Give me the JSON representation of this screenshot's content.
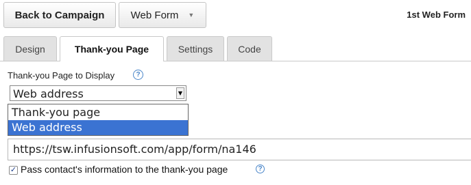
{
  "toolbar": {
    "back_label": "Back to Campaign",
    "form_menu_label": "Web Form",
    "form_title": "1st Web Form"
  },
  "tabs": [
    {
      "label": "Design",
      "active": false
    },
    {
      "label": "Thank-you Page",
      "active": true
    },
    {
      "label": "Settings",
      "active": false
    },
    {
      "label": "Code",
      "active": false
    }
  ],
  "thankyou": {
    "display_label": "Thank-you Page to Display",
    "selected": "Web address",
    "options": [
      "Thank-you page",
      "Web address"
    ],
    "url_value": "https://tsw.infusionsoft.com/app/form/na146",
    "pass_info_label": "Pass contact's information to the thank-you page",
    "pass_info_checked": true
  },
  "colors": {
    "accent": "#3b73d2",
    "help_icon": "#4a86c9"
  }
}
